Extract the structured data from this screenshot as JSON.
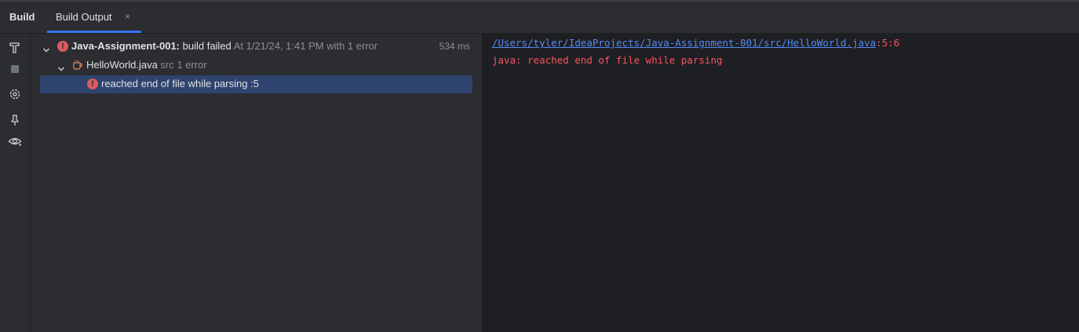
{
  "tool_window": {
    "title": "Build",
    "tabs": [
      {
        "label": "Build Output",
        "close": "×"
      }
    ]
  },
  "tree": {
    "root": {
      "name": "Java-Assignment-001:",
      "status": "build failed",
      "detail": "At 1/21/24, 1:41 PM with 1 error",
      "duration": "534 ms"
    },
    "file": {
      "name": "HelloWorld.java",
      "location": "src",
      "errors": "1 error"
    },
    "message": {
      "text": "reached end of file while parsing :5"
    }
  },
  "output": {
    "path": "/Users/tyler/IdeaProjects/Java-Assignment-001/src/HelloWorld.java",
    "position": ":5:6",
    "message": "java: reached end of file while parsing"
  },
  "colors": {
    "accent": "#3574f0",
    "error": "#db5c5c",
    "link": "#548af7",
    "selection": "#2e436e",
    "panel": "#2b2d30",
    "editor": "#1e1f22"
  },
  "icons": [
    "hammer-icon",
    "stop-icon",
    "settings-icon",
    "pin-icon",
    "eye-icon",
    "chevron-down-icon",
    "error-icon",
    "java-file-icon",
    "close-icon"
  ]
}
